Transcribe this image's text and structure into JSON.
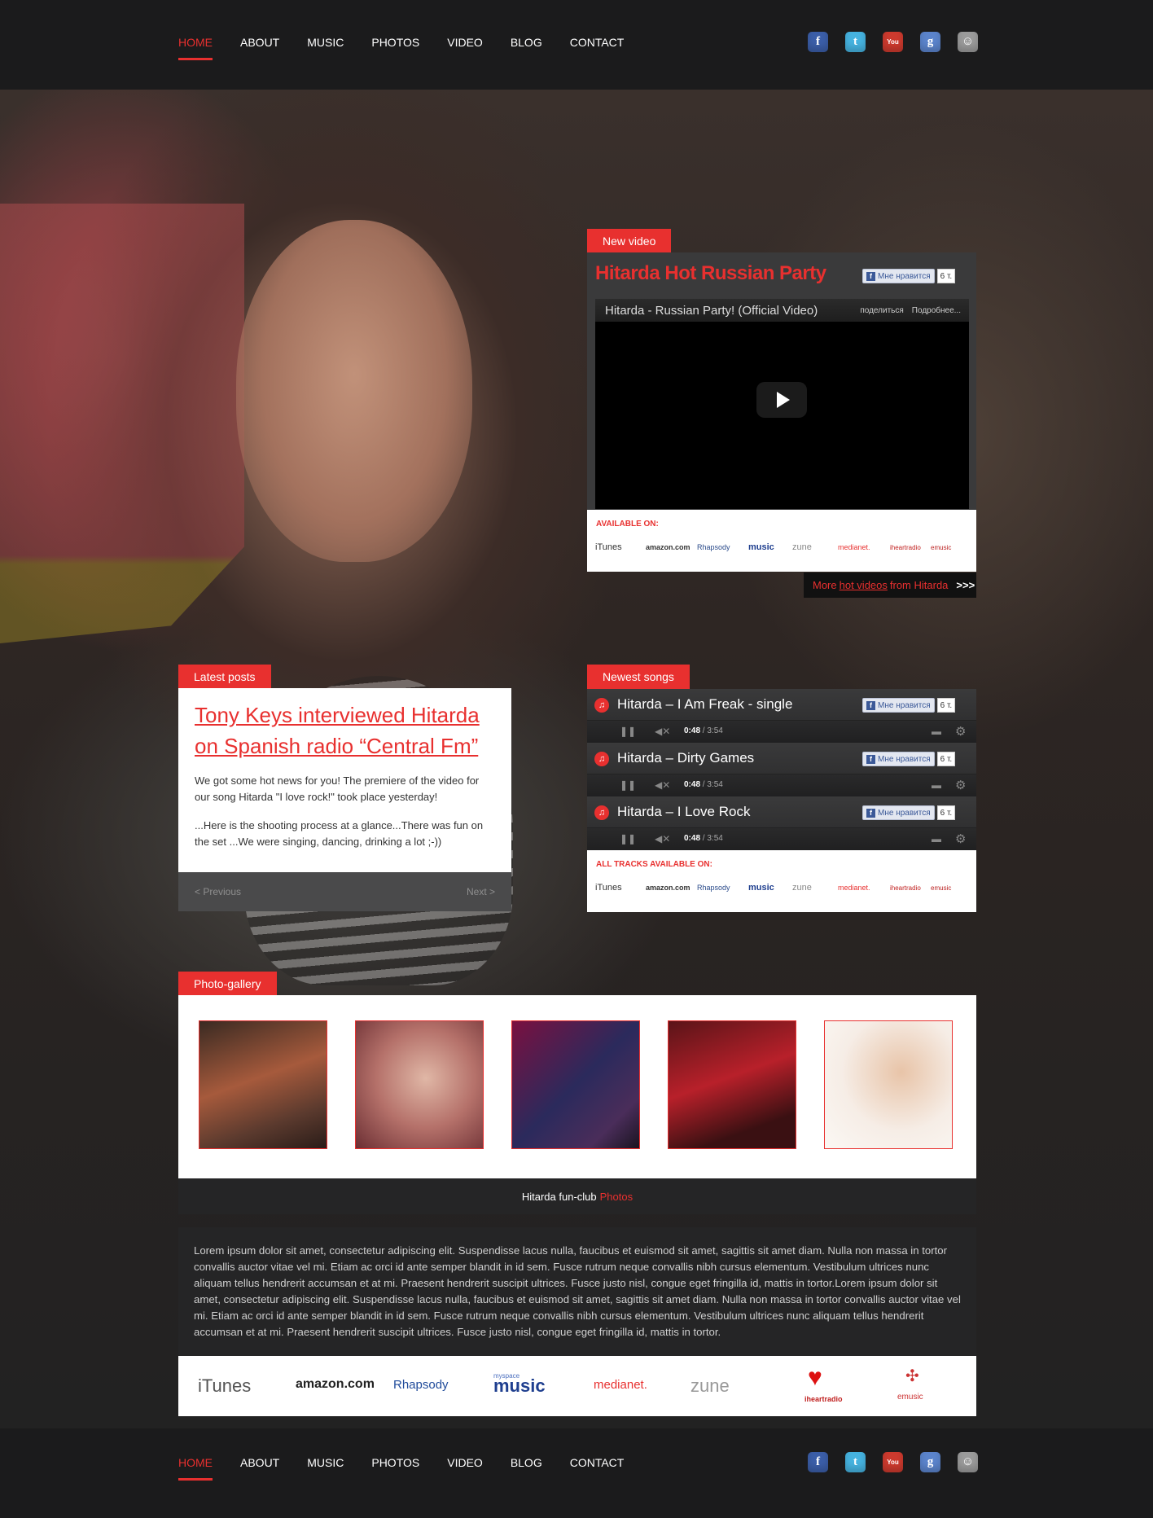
{
  "nav": {
    "items": [
      "HOME",
      "ABOUT",
      "MUSIC",
      "PHOTOS",
      "VIDEO",
      "BLOG",
      "CONTACT"
    ],
    "active": "HOME",
    "socials": [
      {
        "icon": "facebook-icon",
        "glyph": "f"
      },
      {
        "icon": "twitter-icon",
        "glyph": "t"
      },
      {
        "icon": "youtube-icon",
        "glyph": "You"
      },
      {
        "icon": "google-icon",
        "glyph": "g"
      },
      {
        "icon": "smiley-icon",
        "glyph": "☺"
      }
    ]
  },
  "colors": {
    "accent": "#e8302f",
    "panel": "#3a3a3b",
    "bar": "#1b1b1c"
  },
  "video": {
    "tab": "New video",
    "title": "Hitarda Hot Russian Party",
    "like_label": "Мне нравится",
    "like_count": "6 т.",
    "player_title": "Hitarda - Russian Party! (Official Video)",
    "player_share": "поделиться",
    "player_more": "Подробнее...",
    "available_label": "AVAILABLE ON:",
    "more_prefix": "More",
    "more_link": "hot videos",
    "more_suffix": "from Hitarda",
    "more_arrows": ">>>"
  },
  "stores": [
    "iTunes",
    "amazon.com",
    "Rhapsody",
    "music",
    "zune",
    "medianet.",
    "iheartradio",
    "emusic"
  ],
  "stores_small": {
    "itunes": "iTunes",
    "amazon": "amazon.com",
    "rhapsody": "Rhapsody",
    "myspace": "music",
    "zune": "zune",
    "medianet": "medianet.",
    "iheart": "iheartradio",
    "emusic": "emusic"
  },
  "posts": {
    "tab": "Latest posts",
    "title": "Tony Keys interviewed Hitarda on Spanish radio “Central Fm”",
    "para1": "We got some hot news for you! The premiere of the video for our song Hitarda \"I love rock!\" took place yesterday!",
    "para2": "...Here is the shooting process at a glance...There was fun on the set ...We were singing, dancing, drinking a lot ;-))",
    "prev": "< Previous",
    "next": "Next >"
  },
  "songs": {
    "tab": "Newest songs",
    "items": [
      {
        "name": "Hitarda – I Am Freak - single",
        "time": "0:48",
        "total": "/ 3:54"
      },
      {
        "name": "Hitarda – Dirty Games",
        "time": "0:48",
        "total": "/ 3:54"
      },
      {
        "name": "Hitarda – I Love Rock",
        "time": "0:48",
        "total": "/ 3:54"
      }
    ],
    "available_label": "ALL TRACKS AVAILABLE ON:"
  },
  "gallery": {
    "tab": "Photo-gallery",
    "footer_prefix": "Hitarda fun-club",
    "footer_link": "Photos"
  },
  "lorem": "Lorem ipsum dolor sit amet, consectetur adipiscing elit. Suspendisse lacus nulla, faucibus et euismod sit amet, sagittis sit amet diam. Nulla non massa in tortor convallis auctor vitae vel mi. Etiam ac orci id ante semper blandit in id sem. Fusce rutrum neque convallis nibh cursus elementum. Vestibulum ultrices nunc aliquam tellus hendrerit accumsan et at mi. Praesent hendrerit suscipit ultrices. Fusce justo nisl, congue eget fringilla id, mattis in tortor.Lorem ipsum dolor sit amet, consectetur adipiscing elit. Suspendisse lacus nulla, faucibus et euismod sit amet, sagittis sit amet diam. Nulla non massa in tortor convallis auctor vitae vel mi. Etiam ac orci id ante semper blandit in id sem. Fusce rutrum neque convallis nibh cursus elementum. Vestibulum ultrices nunc aliquam tellus hendrerit accumsan et at mi. Praesent hendrerit suscipit ultrices. Fusce justo nisl, congue eget fringilla id, mattis in tortor.",
  "big_stores": {
    "itunes": "iTunes",
    "amazon": "amazon.com",
    "rhapsody": "Rhapsody",
    "myspace_top": "myspace",
    "myspace": "music",
    "medianet": "medianet.",
    "zune": "zune",
    "iheart": "iheartradio",
    "emusic": "emusic"
  }
}
